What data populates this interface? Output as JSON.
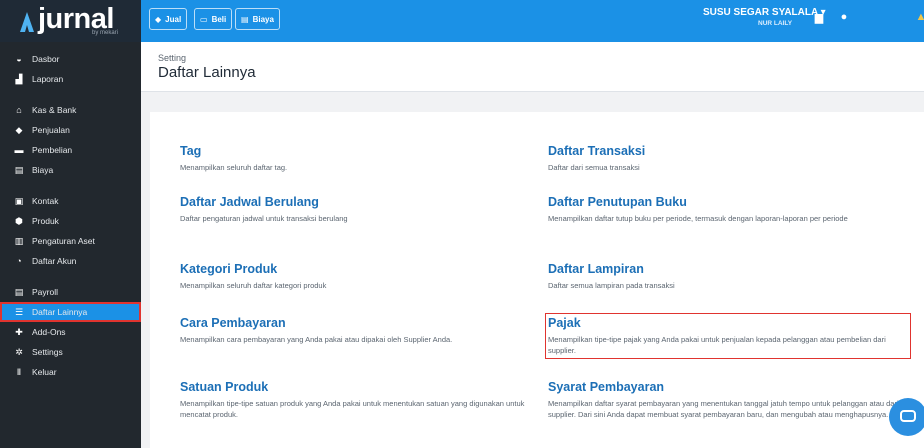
{
  "brand": {
    "name": "jurnal",
    "sub": "by mekari"
  },
  "sidebar": {
    "items": [
      {
        "label": "Dasbor",
        "icon": "dashboard-icon",
        "glyph": "◒"
      },
      {
        "label": "Laporan",
        "icon": "report-icon",
        "glyph": "▟"
      },
      {
        "label": "Kas & Bank",
        "icon": "bank-icon",
        "glyph": "⌂"
      },
      {
        "label": "Penjualan",
        "icon": "tag-icon",
        "glyph": "◆"
      },
      {
        "label": "Pembelian",
        "icon": "card-icon",
        "glyph": "▬"
      },
      {
        "label": "Biaya",
        "icon": "receipt-icon",
        "glyph": "▤"
      },
      {
        "label": "Kontak",
        "icon": "contact-icon",
        "glyph": "▣"
      },
      {
        "label": "Produk",
        "icon": "box-icon",
        "glyph": "⬢"
      },
      {
        "label": "Pengaturan Aset",
        "icon": "asset-icon",
        "glyph": "▥"
      },
      {
        "label": "Daftar Akun",
        "icon": "account-icon",
        "glyph": "◔"
      },
      {
        "label": "Payroll",
        "icon": "payroll-icon",
        "glyph": "▤"
      },
      {
        "label": "Daftar Lainnya",
        "icon": "list-icon",
        "glyph": "☰"
      },
      {
        "label": "Add-Ons",
        "icon": "puzzle-icon",
        "glyph": "✚"
      },
      {
        "label": "Settings",
        "icon": "gear-icon",
        "glyph": "✲"
      },
      {
        "label": "Keluar",
        "icon": "logout-icon",
        "glyph": "Ⅱ"
      }
    ]
  },
  "topbar": {
    "buttons": [
      {
        "label": "Jual",
        "icon": "tag-icon",
        "glyph": "◆"
      },
      {
        "label": "Beli",
        "icon": "card-icon",
        "glyph": "▭"
      },
      {
        "label": "Biaya",
        "icon": "receipt-icon",
        "glyph": "▤"
      }
    ],
    "company": "SUSU SEGAR SYALALA ▾",
    "user": "NUR LAILY"
  },
  "header": {
    "crumb": "Setting",
    "title": "Daftar Lainnya"
  },
  "entries": [
    {
      "title": "Tag",
      "desc": "Menampilkan seluruh daftar tag."
    },
    {
      "title": "Daftar Transaksi",
      "desc": "Daftar dari semua transaksi"
    },
    {
      "title": "Daftar Jadwal Berulang",
      "desc": "Daftar pengaturan jadwal untuk transaksi berulang"
    },
    {
      "title": "Daftar Penutupan Buku",
      "desc": "Menampilkan daftar tutup buku per periode, termasuk dengan laporan-laporan per periode"
    },
    {
      "title": "Kategori Produk",
      "desc": "Menampilkan seluruh daftar kategori produk"
    },
    {
      "title": "Daftar Lampiran",
      "desc": "Daftar semua lampiran pada transaksi"
    },
    {
      "title": "Cara Pembayaran",
      "desc": "Menampilkan cara pembayaran yang Anda pakai atau dipakai oleh Supplier Anda."
    },
    {
      "title": "Pajak",
      "desc": "Menampilkan tipe-tipe pajak yang Anda pakai untuk penjualan kepada pelanggan atau pembelian dari supplier."
    },
    {
      "title": "Satuan Produk",
      "desc": "Menampilkan tipe-tipe satuan produk yang Anda pakai untuk menentukan satuan yang digunakan untuk mencatat produk."
    },
    {
      "title": "Syarat Pembayaran",
      "desc": "Menampilkan daftar syarat pembayaran yang menentukan tanggal jatuh tempo untuk pelanggan atau dari supplier. Dari sini Anda dapat membuat syarat pembayaran baru, dan mengubah atau menghapusnya."
    }
  ],
  "colors": {
    "accent": "#1b91e6",
    "sidebar": "#22282e",
    "highlight": "#e0342f",
    "link": "#1c6fb6"
  }
}
